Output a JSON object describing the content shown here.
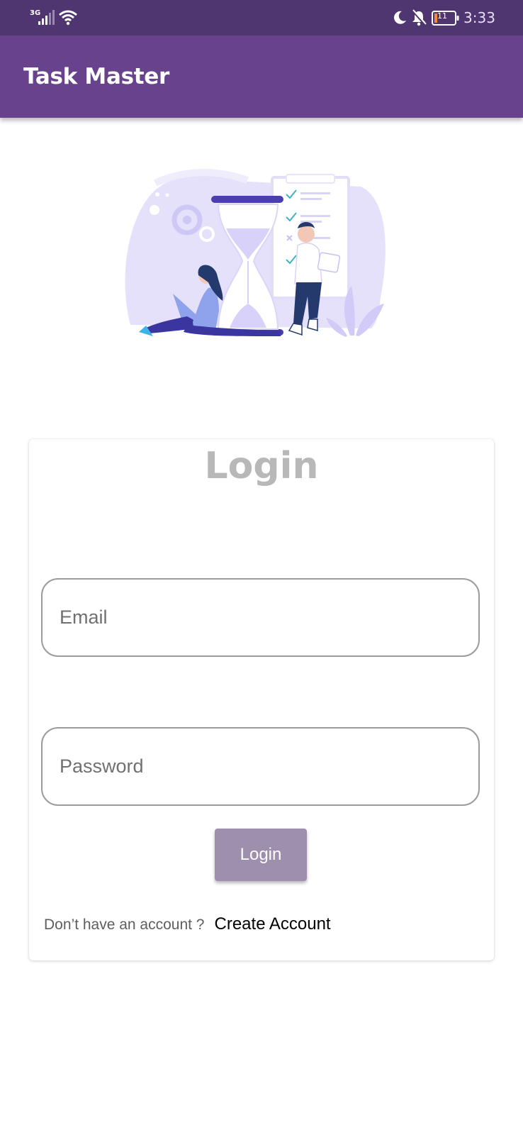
{
  "status_bar": {
    "network": "3G",
    "battery": "11",
    "time": "3:33",
    "icons": [
      "signal-icon",
      "wifi-icon",
      "moon-icon",
      "bell-off-icon",
      "battery-icon"
    ]
  },
  "app_bar": {
    "title": "Task Master",
    "color": "#68428c"
  },
  "login_card": {
    "title": "Login",
    "email_placeholder": "Email",
    "password_placeholder": "Password",
    "button_label": "Login",
    "button_color": "#9e8fae",
    "prompt": "Don’t have an account ?",
    "create_account": "Create Account"
  }
}
